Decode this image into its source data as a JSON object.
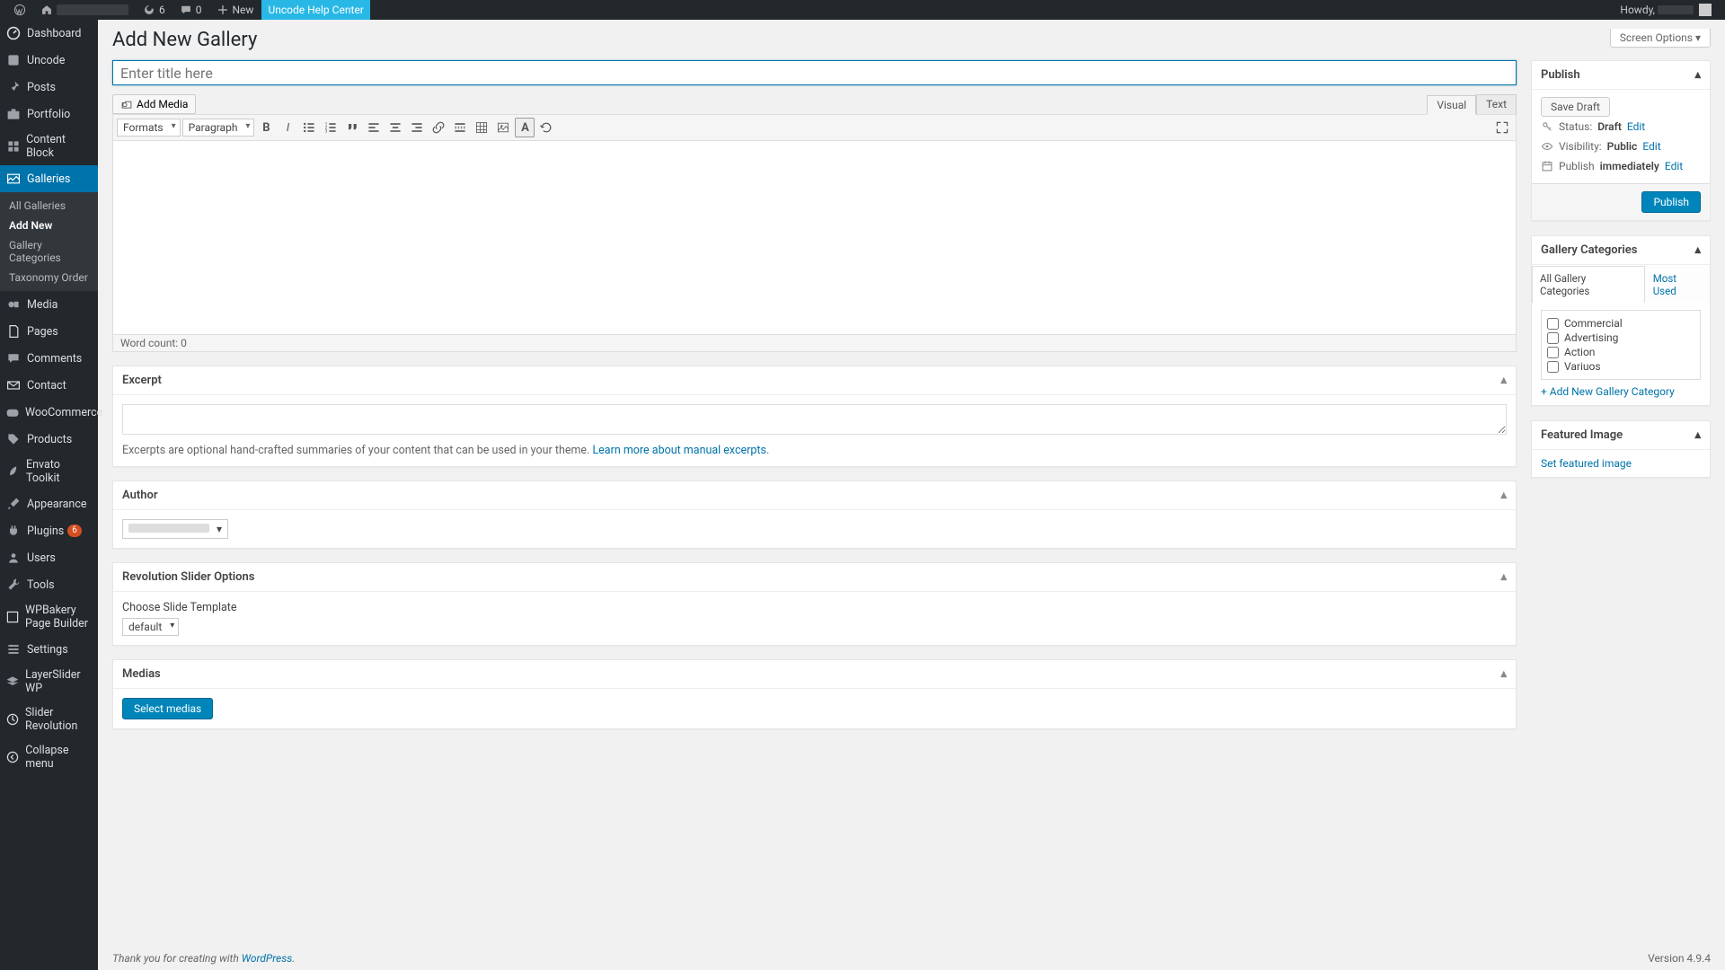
{
  "adminbar": {
    "updates_count": "6",
    "comments_count": "0",
    "new_label": "New",
    "help_center_label": "Uncode Help Center",
    "howdy_prefix": "Howdy,"
  },
  "sidebar": {
    "items": [
      {
        "label": "Dashboard"
      },
      {
        "label": "Uncode"
      },
      {
        "label": "Posts"
      },
      {
        "label": "Portfolio"
      },
      {
        "label": "Content Block"
      },
      {
        "label": "Galleries"
      },
      {
        "label": "Media"
      },
      {
        "label": "Pages"
      },
      {
        "label": "Comments"
      },
      {
        "label": "Contact"
      },
      {
        "label": "WooCommerce"
      },
      {
        "label": "Products"
      },
      {
        "label": "Envato Toolkit"
      },
      {
        "label": "Appearance"
      },
      {
        "label": "Plugins"
      },
      {
        "label": "Users"
      },
      {
        "label": "Tools"
      },
      {
        "label": "WPBakery Page Builder"
      },
      {
        "label": "Settings"
      },
      {
        "label": "LayerSlider WP"
      },
      {
        "label": "Slider Revolution"
      },
      {
        "label": "Collapse menu"
      }
    ],
    "galleries_sub": [
      {
        "label": "All Galleries"
      },
      {
        "label": "Add New"
      },
      {
        "label": "Gallery Categories"
      },
      {
        "label": "Taxonomy Order"
      }
    ],
    "plugins_badge": "6"
  },
  "page": {
    "title": "Add New Gallery",
    "screen_options": "Screen Options",
    "title_placeholder": "Enter title here"
  },
  "editor": {
    "add_media": "Add Media",
    "tab_visual": "Visual",
    "tab_text": "Text",
    "formats_label": "Formats",
    "paragraph_label": "Paragraph",
    "word_count_label": "Word count: 0"
  },
  "excerpt": {
    "title": "Excerpt",
    "hint_pre": "Excerpts are optional hand-crafted summaries of your content that can be used in your theme. ",
    "hint_link": "Learn more about manual excerpts"
  },
  "author": {
    "title": "Author"
  },
  "revslider": {
    "title": "Revolution Slider Options",
    "choose_label": "Choose Slide Template",
    "default_option": "default"
  },
  "medias": {
    "title": "Medias",
    "button": "Select medias"
  },
  "publish": {
    "title": "Publish",
    "save_draft": "Save Draft",
    "status_label": "Status:",
    "status_value": "Draft",
    "visibility_label": "Visibility:",
    "visibility_value": "Public",
    "publish_label": "Publish",
    "publish_value": "immediately",
    "edit": "Edit",
    "publish_btn": "Publish"
  },
  "gallery_categories": {
    "title": "Gallery Categories",
    "tab_all": "All Gallery Categories",
    "tab_most": "Most Used",
    "items": [
      "Commercial",
      "Advertising",
      "Action",
      "Variuos"
    ],
    "add_new": "+ Add New Gallery Category"
  },
  "featured_image": {
    "title": "Featured Image",
    "link": "Set featured image"
  },
  "footer": {
    "thanks_pre": "Thank you for creating with ",
    "wp": "WordPress",
    "version": "Version 4.9.4"
  }
}
